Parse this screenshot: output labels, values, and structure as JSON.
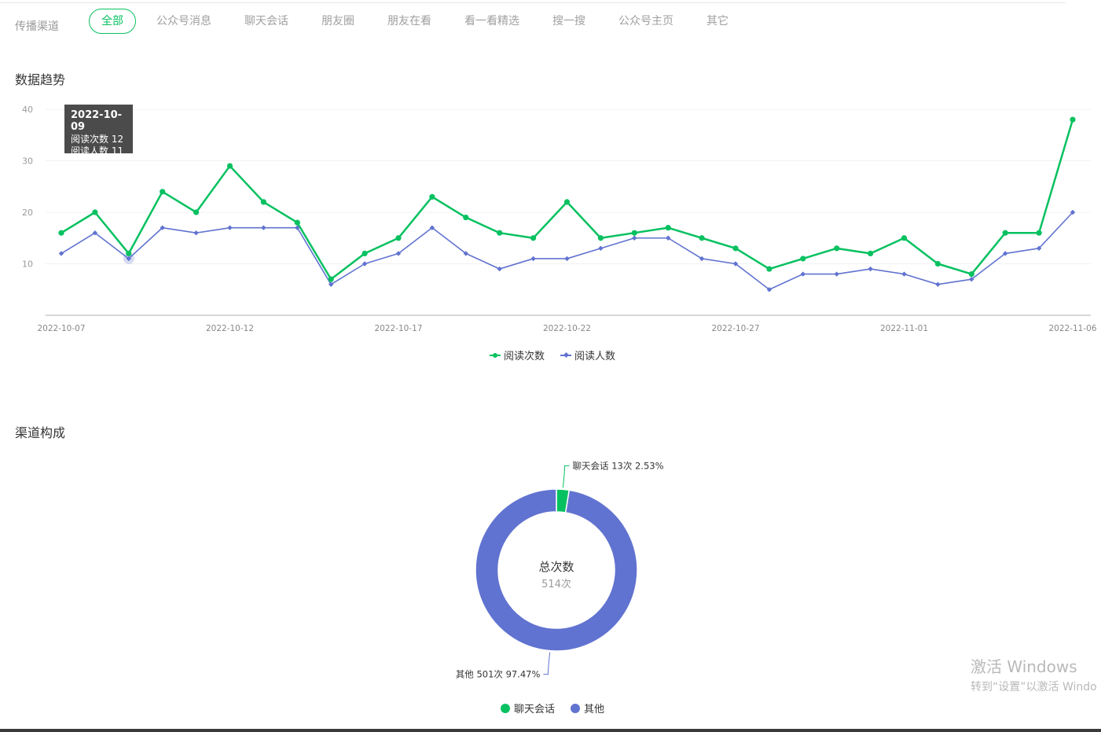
{
  "channel_filter": {
    "label": "传播渠道",
    "tabs": [
      {
        "label": "全部",
        "active": true
      },
      {
        "label": "公众号消息",
        "active": false
      },
      {
        "label": "聊天会话",
        "active": false
      },
      {
        "label": "朋友圈",
        "active": false
      },
      {
        "label": "朋友在看",
        "active": false
      },
      {
        "label": "看一看精选",
        "active": false
      },
      {
        "label": "搜一搜",
        "active": false
      },
      {
        "label": "公众号主页",
        "active": false
      },
      {
        "label": "其它",
        "active": false
      }
    ]
  },
  "trend_section": {
    "title": "数据趋势"
  },
  "channel_section": {
    "title": "渠道构成"
  },
  "tooltip": {
    "date": "2022-10-09",
    "line1": "阅读次数 12",
    "line2": "阅读人数 11"
  },
  "colors": {
    "green": "#07c160",
    "blue": "#6173d0",
    "accent": "#07c160"
  },
  "watermark": {
    "line1": "激活 Windows",
    "line2": "转到“设置”以激活 Windo"
  },
  "chart_data": [
    {
      "type": "line",
      "x": [
        "2022-10-07",
        "2022-10-08",
        "2022-10-09",
        "2022-10-10",
        "2022-10-11",
        "2022-10-12",
        "2022-10-13",
        "2022-10-14",
        "2022-10-15",
        "2022-10-16",
        "2022-10-17",
        "2022-10-18",
        "2022-10-19",
        "2022-10-20",
        "2022-10-21",
        "2022-10-22",
        "2022-10-23",
        "2022-10-24",
        "2022-10-25",
        "2022-10-26",
        "2022-10-27",
        "2022-10-28",
        "2022-10-29",
        "2022-10-30",
        "2022-10-31",
        "2022-11-01",
        "2022-11-02",
        "2022-11-03",
        "2022-11-04",
        "2022-11-05",
        "2022-11-06"
      ],
      "x_tick_labels": [
        "2022-10-07",
        "2022-10-12",
        "2022-10-17",
        "2022-10-22",
        "2022-10-27",
        "2022-11-01",
        "2022-11-06"
      ],
      "y_ticks": [
        10,
        20,
        30,
        40
      ],
      "ylim": [
        0,
        40
      ],
      "grid": true,
      "legend_position": "bottom-center",
      "highlighted_x": "2022-10-09",
      "series": [
        {
          "name": "阅读次数",
          "color": "#07c160",
          "marker": "circle",
          "values": [
            16,
            20,
            12,
            24,
            20,
            29,
            22,
            18,
            7,
            12,
            15,
            23,
            19,
            16,
            15,
            22,
            15,
            16,
            17,
            15,
            13,
            9,
            11,
            13,
            12,
            15,
            10,
            8,
            16,
            16,
            38
          ]
        },
        {
          "name": "阅读人数",
          "color": "#6173d0",
          "marker": "diamond",
          "values": [
            12,
            16,
            11,
            17,
            16,
            17,
            17,
            17,
            6,
            10,
            12,
            17,
            12,
            9,
            11,
            11,
            13,
            15,
            15,
            11,
            10,
            5,
            8,
            8,
            9,
            8,
            6,
            7,
            12,
            13,
            20
          ]
        }
      ]
    },
    {
      "type": "pie",
      "variant": "donut",
      "center_title": "总次数",
      "center_value": "514次",
      "legend_position": "bottom-center",
      "slices": [
        {
          "name": "聊天会话",
          "value": 13,
          "percent": 2.53,
          "label": "聊天会话 13次 2.53%",
          "color": "#07c160"
        },
        {
          "name": "其他",
          "value": 501,
          "percent": 97.47,
          "label": "其他 501次 97.47%",
          "color": "#6173d0"
        }
      ]
    }
  ]
}
